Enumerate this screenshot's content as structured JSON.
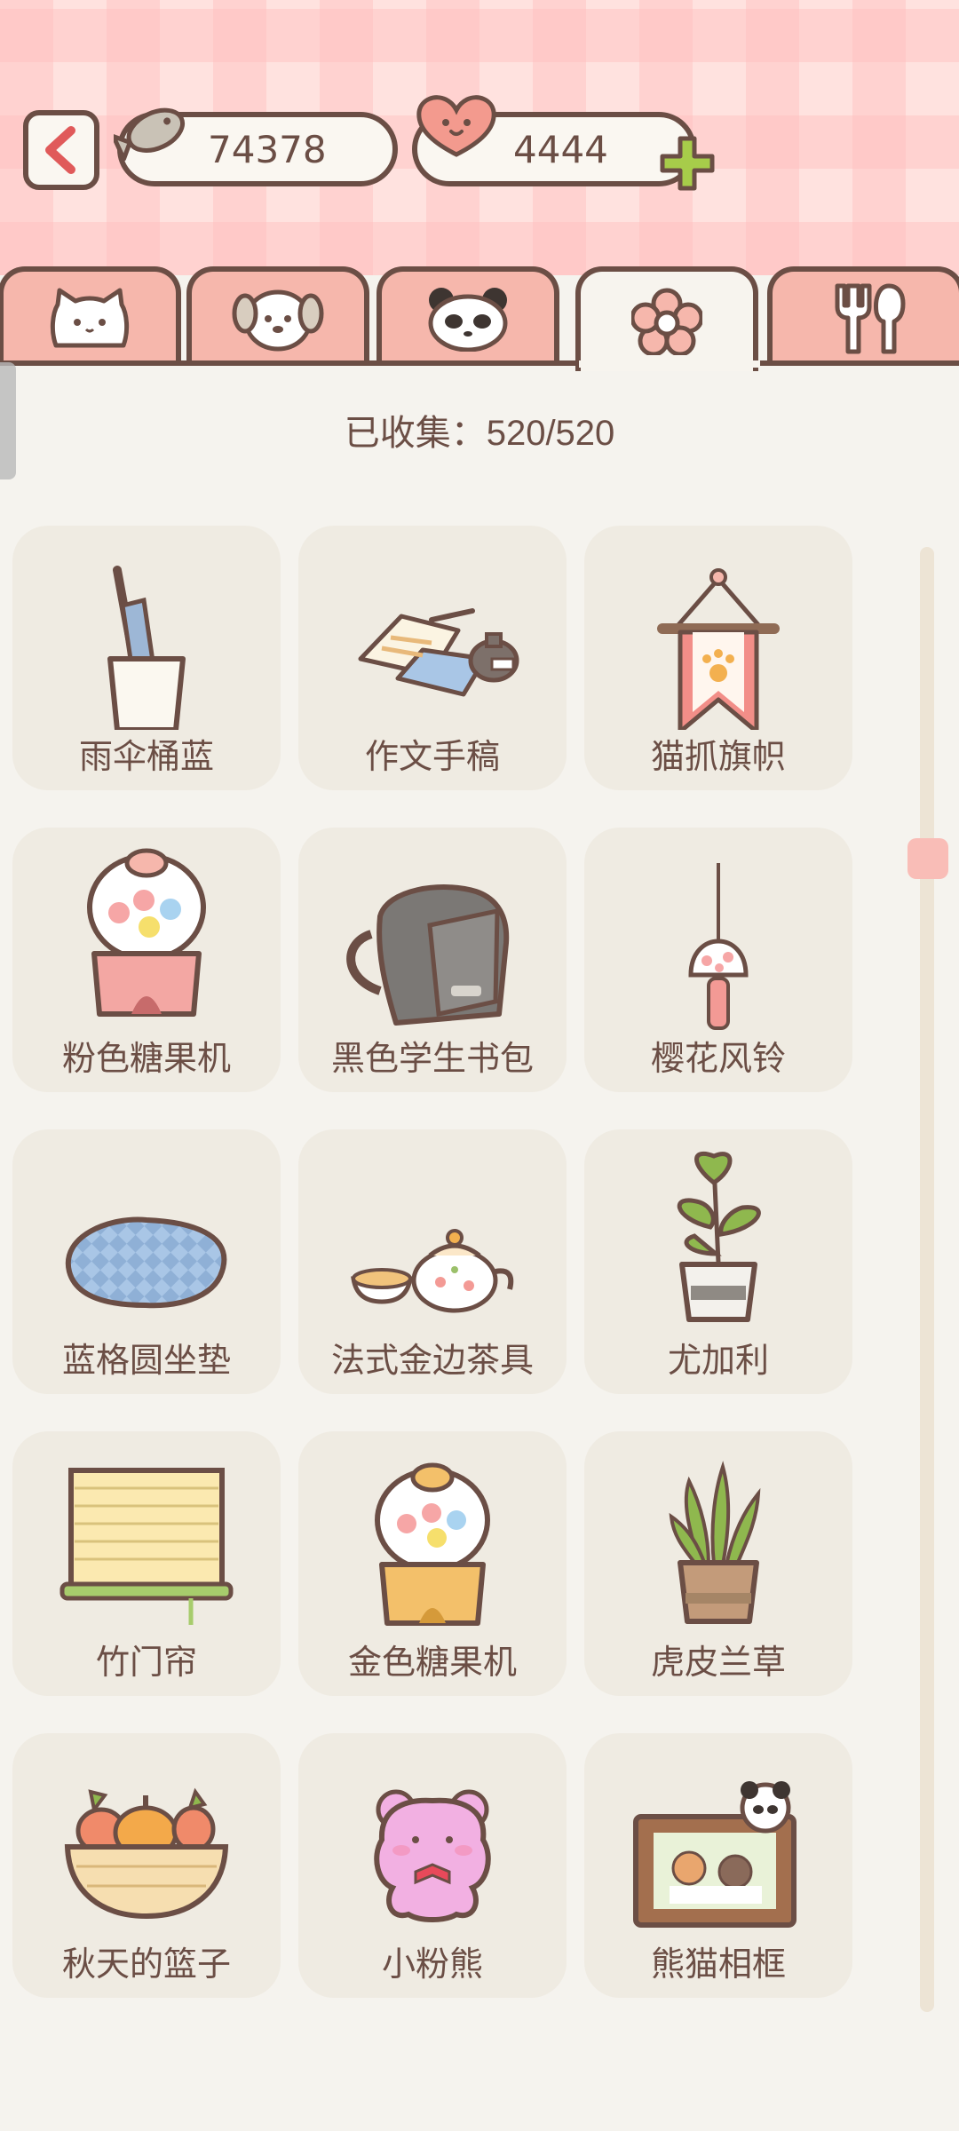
{
  "header": {
    "fish_count": "74378",
    "heart_count": "4444",
    "icons": [
      "back-arrow-icon",
      "fish-icon",
      "heart-icon",
      "plus-icon"
    ]
  },
  "tabs": [
    {
      "name": "cat",
      "icon": "cat-icon"
    },
    {
      "name": "dog",
      "icon": "dog-icon"
    },
    {
      "name": "panda",
      "icon": "panda-icon"
    },
    {
      "name": "flower",
      "icon": "flower-icon",
      "active": true
    },
    {
      "name": "food",
      "icon": "fork-spoon-icon"
    }
  ],
  "collection": {
    "label": "已收集：",
    "progress": "520/520"
  },
  "items": [
    {
      "label": "雨伞桶蓝"
    },
    {
      "label": "作文手稿"
    },
    {
      "label": "猫抓旗帜"
    },
    {
      "label": "粉色糖果机"
    },
    {
      "label": "黑色学生书包"
    },
    {
      "label": "樱花风铃"
    },
    {
      "label": "蓝格圆坐垫"
    },
    {
      "label": "法式金边茶具"
    },
    {
      "label": "尤加利"
    },
    {
      "label": "竹门帘"
    },
    {
      "label": "金色糖果机"
    },
    {
      "label": "虎皮兰草"
    },
    {
      "label": "秋天的篮子"
    },
    {
      "label": "小粉熊"
    },
    {
      "label": "熊猫相框"
    }
  ],
  "colors": {
    "outline": "#6b4e45",
    "tab_pink": "#f6b7ac",
    "card_bg": "#efebe2",
    "page_bg": "#f5f3ee",
    "accent_green": "#a7cc4a"
  },
  "scroll": {
    "position": 0.2
  }
}
